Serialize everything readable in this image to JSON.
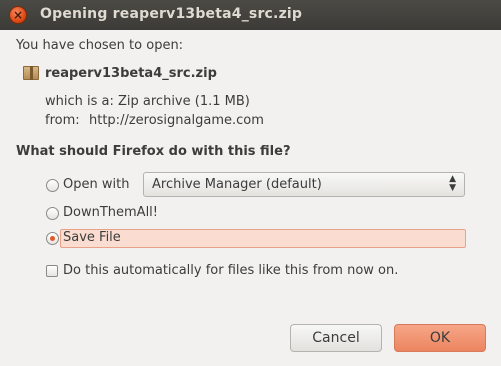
{
  "window": {
    "title": "Opening reaperv13beta4_src.zip"
  },
  "intro": "You have chosen to open:",
  "file": {
    "name": "reaperv13beta4_src.zip",
    "type_label": "which is a:",
    "type_value": "Zip archive (1.1 MB)",
    "from_label": "from:",
    "from_value": "http://zerosignalgame.com"
  },
  "question": "What should Firefox do with this file?",
  "options": {
    "open_with": "Open with",
    "app_selected": "Archive Manager (default)",
    "downthemall": "DownThemAll!",
    "save_file": "Save File",
    "selected": "save_file"
  },
  "auto": {
    "label": "Do this automatically for files like this from now on.",
    "checked": false
  },
  "buttons": {
    "cancel": "Cancel",
    "ok": "OK"
  }
}
